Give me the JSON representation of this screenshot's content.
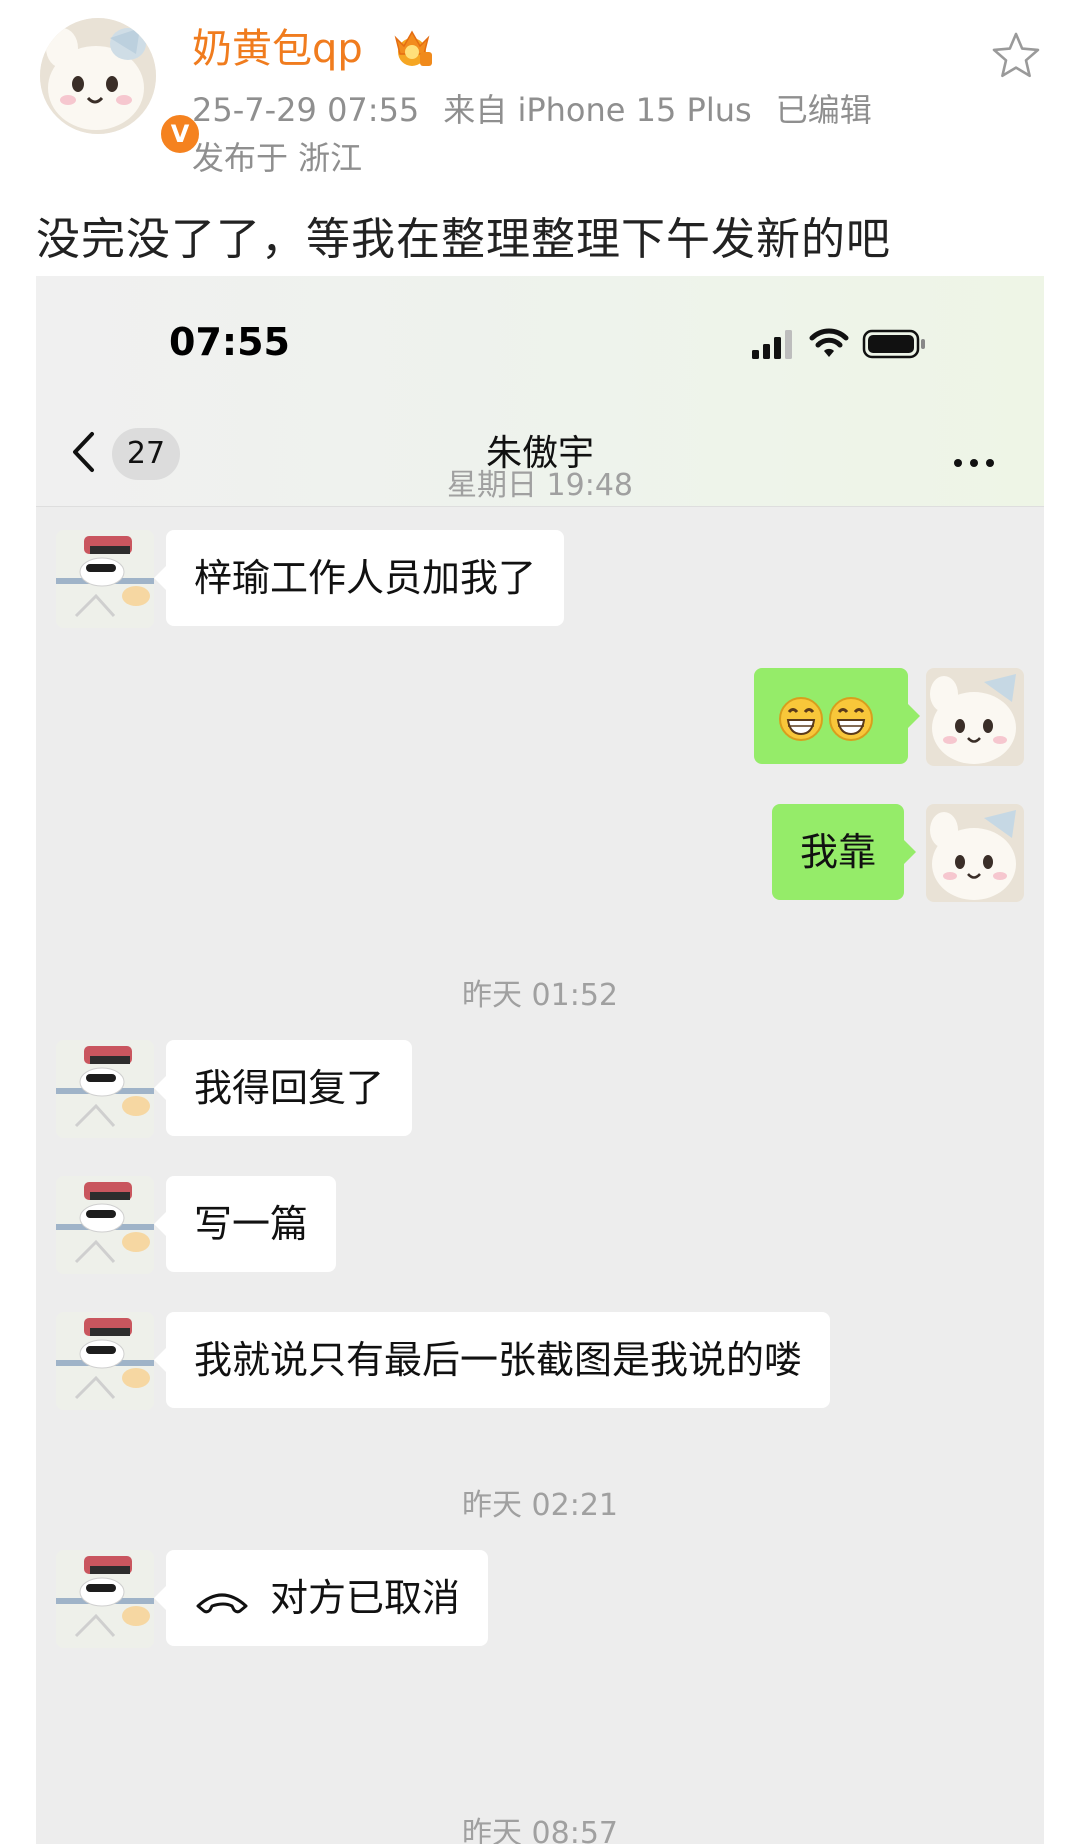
{
  "post": {
    "username": "奶黄包qp",
    "date": "25-7-29 07:55",
    "source": "来自 iPhone 15 Plus",
    "edited": "已编辑",
    "location": "发布于 浙江",
    "text": "没完没了了，等我在整理整理下午发新的吧",
    "badge": "V"
  },
  "screenshot": {
    "status_time": "07:55",
    "back_count": "27",
    "chat_title": "朱傲宇",
    "messages": [
      {
        "type": "time",
        "text": "星期日 19:48"
      },
      {
        "type": "in",
        "text": "梓瑜工作人员加我了"
      },
      {
        "type": "out",
        "emoji": "grin-emoji x2"
      },
      {
        "type": "out",
        "text": "我靠"
      },
      {
        "type": "time",
        "text": "昨天 01:52"
      },
      {
        "type": "in",
        "text": "我得回复了"
      },
      {
        "type": "in",
        "text": "写一篇"
      },
      {
        "type": "in",
        "text": "我就说只有最后一张截图是我说的喽"
      },
      {
        "type": "time",
        "text": "昨天 02:21"
      },
      {
        "type": "in",
        "text": "对方已取消",
        "icon": "phone-hangup-icon"
      },
      {
        "type": "time",
        "text": "昨天 08:57"
      }
    ]
  },
  "colors": {
    "username": "#f07c1e",
    "out_bubble": "#95ec69",
    "chat_bg": "#ededed"
  }
}
